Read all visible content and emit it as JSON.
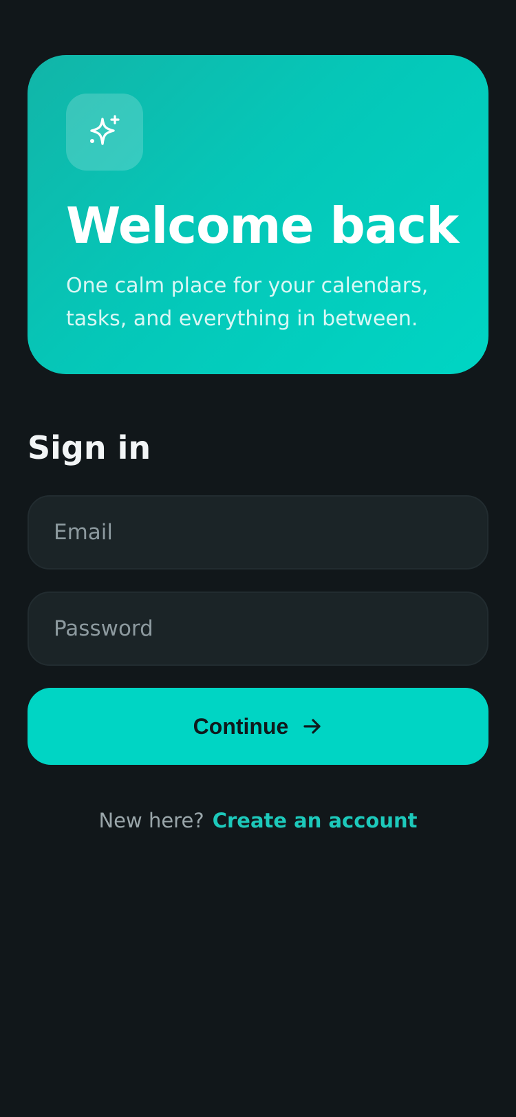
{
  "hero": {
    "icon": "sparkles-icon",
    "title": "Welcome back",
    "subtitle": "One calm place for your calendars, tasks, and everything in between."
  },
  "form": {
    "heading": "Sign in",
    "email": {
      "value": "",
      "placeholder": "Email"
    },
    "password": {
      "value": "",
      "placeholder": "Password"
    },
    "submit_label": "Continue",
    "submit_icon": "arrow-right-icon"
  },
  "footer": {
    "prompt": "New here?",
    "link_label": "Create an account"
  },
  "colors": {
    "background": "#11171a",
    "accent": "#00d5c4",
    "field_background": "#1b2427",
    "link": "#1dc9bb"
  }
}
